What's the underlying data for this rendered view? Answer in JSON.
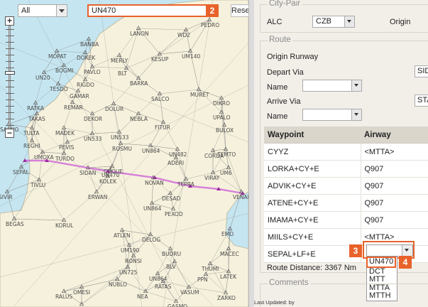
{
  "map": {
    "filter_value": "All",
    "search_value": "UN470",
    "reset_label": "Reset",
    "route_color": "#d06bd8",
    "badge_search": "2",
    "waypoints": [
      {
        "label": "LANON"
      },
      {
        "label": "WD2"
      },
      {
        "label": "BANBA"
      },
      {
        "label": "PEDRO"
      },
      {
        "label": "MOPAT"
      },
      {
        "label": "DOKEK"
      },
      {
        "label": "MERLY"
      },
      {
        "label": "KESUP"
      },
      {
        "label": "UM140"
      },
      {
        "label": "BOGMI"
      },
      {
        "label": "PAVLO"
      },
      {
        "label": "BLT"
      },
      {
        "label": "UN20"
      },
      {
        "label": "TESDO"
      },
      {
        "label": "RIGDO"
      },
      {
        "label": "GAMAR"
      },
      {
        "label": "BARKA"
      },
      {
        "label": "SALCO"
      },
      {
        "label": "MURET"
      },
      {
        "label": "DIKRO"
      },
      {
        "label": "RATKA"
      },
      {
        "label": "REMAR"
      },
      {
        "label": "DOLUR"
      },
      {
        "label": "TAKAS"
      },
      {
        "label": "DEKOR"
      },
      {
        "label": "NEBLA"
      },
      {
        "label": "UPALO"
      },
      {
        "label": "SASNO"
      },
      {
        "label": "TULTA"
      },
      {
        "label": "MADEK"
      },
      {
        "label": "BULOX"
      },
      {
        "label": "FITUR"
      },
      {
        "label": "REGHI"
      },
      {
        "label": "PEVIS"
      },
      {
        "label": "UN533"
      },
      {
        "label": "UN533"
      },
      {
        "label": "ROSMU"
      },
      {
        "label": "UN482"
      },
      {
        "label": "TEMTO"
      },
      {
        "label": "UMOXA"
      },
      {
        "label": "TURDO"
      },
      {
        "label": "ADERI"
      },
      {
        "label": "CORDA"
      },
      {
        "label": "SEPAL"
      },
      {
        "label": "SIDAN"
      },
      {
        "label": "COQUE"
      },
      {
        "label": "KOLEK"
      },
      {
        "label": "NOVAN"
      },
      {
        "label": "TEPRA"
      },
      {
        "label": "VIRAY"
      },
      {
        "label": "VENAR"
      },
      {
        "label": "TIVLU"
      },
      {
        "label": "SIVIR"
      },
      {
        "label": "ERWAN"
      },
      {
        "label": "DESAD"
      },
      {
        "label": "PEXOD"
      },
      {
        "label": "BEGAS"
      },
      {
        "label": "KORUL"
      },
      {
        "label": "ATLEN"
      },
      {
        "label": "DELOG"
      },
      {
        "label": "EMO"
      },
      {
        "label": "UM190"
      },
      {
        "label": "BUDRU"
      },
      {
        "label": "MACEC"
      },
      {
        "label": "RONSI"
      },
      {
        "label": "BLV"
      },
      {
        "label": "UN725"
      },
      {
        "label": "THUMI"
      },
      {
        "label": "LATEK"
      },
      {
        "label": "NUBLO"
      },
      {
        "label": "RATAS"
      },
      {
        "label": "PPN"
      },
      {
        "label": "OMESI"
      },
      {
        "label": "RALUS"
      },
      {
        "label": "NEA"
      },
      {
        "label": "VASUM"
      },
      {
        "label": "ZARKO"
      },
      {
        "label": "GASMO"
      },
      {
        "label": "ADORO"
      },
      {
        "label": "UN864"
      },
      {
        "label": "UN864"
      },
      {
        "label": "UN864"
      },
      {
        "label": "UM6"
      },
      {
        "label": "UN470"
      }
    ]
  },
  "panel": {
    "city_pair_legend": "City-Pair",
    "city_pair_label": "ALC",
    "city_pair_value": "CZB",
    "origin_label": "Origin",
    "route_legend": "Route",
    "origin_runway_label": "Origin Runway",
    "depart_via_label": "Depart Via",
    "depart_via_value": "SID",
    "name_label": "Name",
    "arrive_via_label": "Arrive Via",
    "arrive_via_value": "STA",
    "name2_label": "Name",
    "table": {
      "headers": [
        "Waypoint",
        "Airway"
      ],
      "rows": [
        {
          "waypoint": "CYYZ",
          "airway": "<MTTA>"
        },
        {
          "waypoint": "LORKA+CY+E",
          "airway": "Q907"
        },
        {
          "waypoint": "ADVIK+CY+E",
          "airway": "Q907"
        },
        {
          "waypoint": "ATENE+CY+E",
          "airway": "Q907"
        },
        {
          "waypoint": "IMAMA+CY+E",
          "airway": "Q907"
        },
        {
          "waypoint": "MIILS+CY+E",
          "airway": "<MTTA>"
        },
        {
          "waypoint": "SEPAL+LF+E",
          "airway": ""
        }
      ]
    },
    "badge_row": "3",
    "badge_option": "4",
    "airway_options": [
      "UN470",
      "DCT",
      "MTT",
      "MTTA",
      "MTTH"
    ],
    "route_distance": "Route Distance: 3367 Nm",
    "comments_legend": "Comments",
    "last_updated": "Last Updated: by"
  }
}
